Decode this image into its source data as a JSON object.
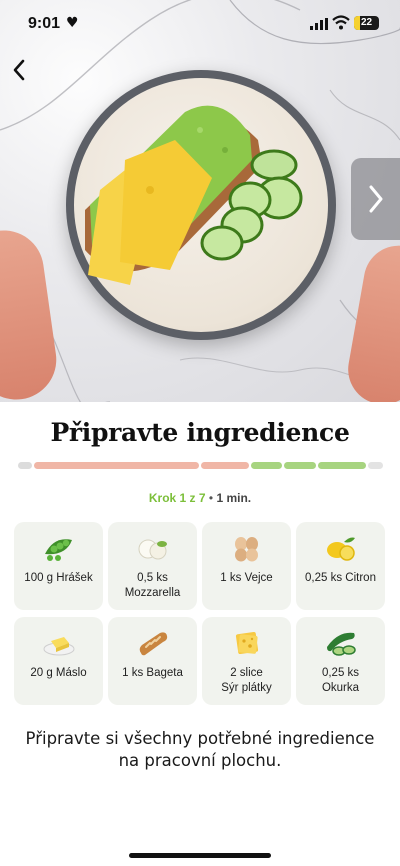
{
  "status_bar": {
    "time": "9:01",
    "battery": "22"
  },
  "hero": {
    "image_description_icon": "food-photo"
  },
  "title": "Připravte ingredience",
  "progress": {
    "segments": [
      "gray",
      "salmon",
      "salmon",
      "green",
      "green",
      "green",
      "light"
    ],
    "colors": {
      "gray": "#dcdcdc",
      "salmon": "#f0b6a6",
      "green": "#a7d480",
      "light": "#e3e3e3"
    }
  },
  "step": {
    "krok": "Krok 1 z 7",
    "separator": "•",
    "duration": "1 min."
  },
  "ingredients": [
    {
      "label": "100 g Hrášek",
      "icon": "peas-icon"
    },
    {
      "label": "0,5 ks\nMozzarella",
      "icon": "mozzarella-icon"
    },
    {
      "label": "1 ks Vejce",
      "icon": "eggs-icon"
    },
    {
      "label": "0,25 ks Citron",
      "icon": "lemon-icon"
    },
    {
      "label": "20 g Máslo",
      "icon": "butter-icon"
    },
    {
      "label": "1 ks Bageta",
      "icon": "baguette-icon"
    },
    {
      "label": "2 slice\nSýr plátky",
      "icon": "cheese-slices-icon"
    },
    {
      "label": "0,25 ks\nOkurka",
      "icon": "cucumber-icon"
    }
  ],
  "description": "Připravte si všechny potřebné ingredience na pracovní plochu.",
  "accent_color": "#7cbf3a"
}
